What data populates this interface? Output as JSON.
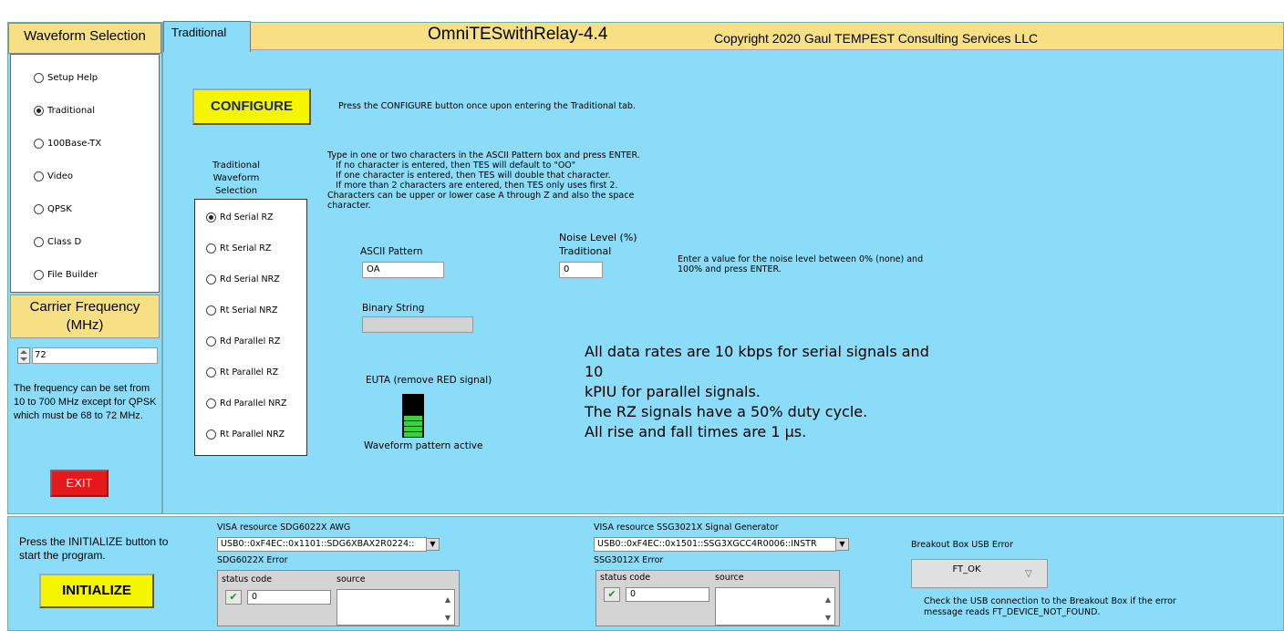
{
  "left": {
    "title": "Waveform Selection",
    "options": [
      "Setup Help",
      "Traditional",
      "100Base-TX",
      "Video",
      "QPSK",
      "Class D",
      "File Builder"
    ],
    "selected_index": 1,
    "carrier_title": "Carrier Frequency (MHz)",
    "frequency_value": "72",
    "frequency_help": "The frequency can be set from 10 to 700 MHz except for QPSK which must be 68 to 72 MHz.",
    "exit_label": "EXIT"
  },
  "main": {
    "tab_label": "Traditional",
    "app_title": "OmniTESwithRelay-4.4",
    "copyright": "Copyright 2020 Gaul TEMPEST Consulting Services LLC",
    "configure_label": "CONFIGURE",
    "configure_hint": "Press the CONFIGURE button once upon entering the Traditional tab.",
    "traditional_label": "Traditional Waveform Selection",
    "waveform_options": [
      "Rd Serial RZ",
      "Rt Serial RZ",
      "Rd Serial NRZ",
      "Rt Serial NRZ",
      "Rd Parallel RZ",
      "Rt Parallel RZ",
      "Rd Parallel NRZ",
      "Rt Parallel NRZ"
    ],
    "waveform_selected_index": 0,
    "ascii_help": "Type in one or two characters in the ASCII Pattern box and press ENTER.\n   If no character is entered, then TES will default to \"OO\"\n   If one character is entered, then TES will double that character.\n   If more than 2 characters are entered, then TES only uses first 2.\nCharacters can be upper or lower case A through Z and also the space character.",
    "ascii_label": "ASCII Pattern",
    "ascii_value": "OA",
    "binary_label": "Binary String",
    "binary_value": "",
    "noise_label_1": "Noise Level (%)",
    "noise_label_2": "Traditional",
    "noise_value": "0",
    "noise_help": "Enter a value for the noise level between 0% (none) and 100% and press ENTER.",
    "euta_label": "EUTA (remove RED signal)",
    "waveform_active_label": "Waveform pattern active",
    "rates_line_1": "All data rates are 10 kbps for serial signals and 10",
    "rates_line_2": "kPIU for parallel signals.",
    "rates_line_3": "The RZ signals have a 50% duty cycle.",
    "rates_line_4": "All rise and fall times are 1 µs."
  },
  "bottom": {
    "init_hint": "Press the INITIALIZE button to start the program.",
    "init_label": "INITIALIZE",
    "awg_label": "VISA resource SDG6022X AWG",
    "awg_value": "USB0::0xF4EC::0x1101::SDG6XBAX2R0224::",
    "awg_error_label": "SDG6022X Error",
    "siggen_label": "VISA resource SSG3021X Signal Generator",
    "siggen_value": "USB0::0xF4EC::0x1501::SSG3XGCC4R0006::INSTR",
    "siggen_error_label": "SSG3012X Error",
    "status_code_label": "status code",
    "source_label": "source",
    "status_code_value": "0",
    "usb_error_label": "Breakout Box USB Error",
    "usb_error_value": "FT_OK",
    "usb_help": "Check the USB connection to the Breakout Box if the error message reads FT_DEVICE_NOT_FOUND."
  },
  "colors": {
    "panel": "#8adcf8",
    "header": "#f7df84",
    "button_yellow": "#f5f500",
    "exit_red": "#e51919"
  }
}
